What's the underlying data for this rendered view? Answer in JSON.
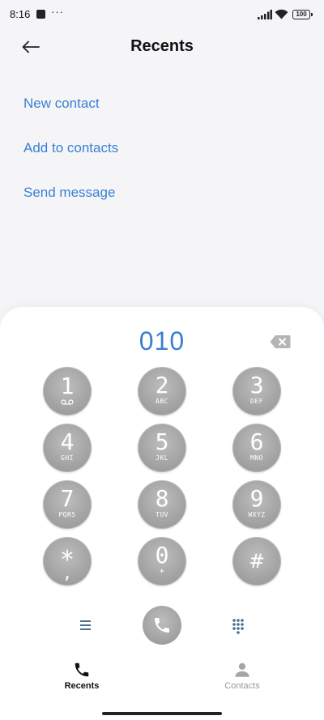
{
  "status_bar": {
    "time": "8:16",
    "notification_dots": "···",
    "battery_level": "100"
  },
  "header": {
    "title": "Recents",
    "back_icon": "arrow-left-icon"
  },
  "actions": {
    "new_contact": "New contact",
    "add_to_contacts": "Add to contacts",
    "send_message": "Send message"
  },
  "dialer": {
    "number": "010",
    "keys": [
      {
        "digit": "1",
        "letters": ""
      },
      {
        "digit": "2",
        "letters": "ABC"
      },
      {
        "digit": "3",
        "letters": "DEF"
      },
      {
        "digit": "4",
        "letters": "GHI"
      },
      {
        "digit": "5",
        "letters": "JKL"
      },
      {
        "digit": "6",
        "letters": "MNO"
      },
      {
        "digit": "7",
        "letters": "PQRS"
      },
      {
        "digit": "8",
        "letters": "TUV"
      },
      {
        "digit": "9",
        "letters": "WXYZ"
      },
      {
        "digit": "*",
        "letters": ","
      },
      {
        "digit": "0",
        "letters": "+"
      },
      {
        "digit": "#",
        "letters": ""
      }
    ]
  },
  "bottom_nav": {
    "recents_label": "Recents",
    "contacts_label": "Contacts"
  },
  "colors": {
    "accent": "#3a7fd5",
    "key_gray": "#a3a3a3",
    "icon_blue_gray": "#4a6d8c"
  }
}
